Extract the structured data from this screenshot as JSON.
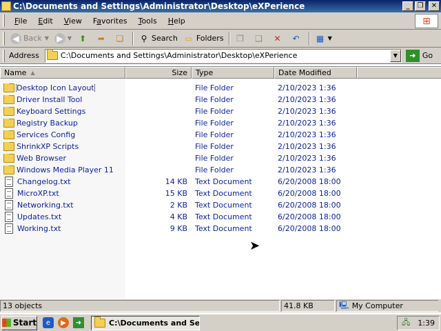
{
  "window": {
    "title": "C:\\Documents and Settings\\Administrator\\Desktop\\eXPerience",
    "controls": {
      "minimize": "_",
      "maximize": "❐",
      "close": "✕"
    }
  },
  "menubar": [
    {
      "label": "File",
      "accel": "F"
    },
    {
      "label": "Edit",
      "accel": "E"
    },
    {
      "label": "View",
      "accel": "V"
    },
    {
      "label": "Favorites",
      "accel": "a"
    },
    {
      "label": "Tools",
      "accel": "T"
    },
    {
      "label": "Help",
      "accel": "H"
    }
  ],
  "toolbar": {
    "back_label": "Back",
    "search_label": "Search",
    "folders_label": "Folders"
  },
  "address": {
    "label": "Address",
    "value": "C:\\Documents and Settings\\Administrator\\Desktop\\eXPerience",
    "go_label": "Go"
  },
  "columns": {
    "name": "Name",
    "size": "Size",
    "type": "Type",
    "date": "Date Modified"
  },
  "files": [
    {
      "name": "Desktop Icon Layout",
      "size": "",
      "type": "File Folder",
      "date": "2/10/2023 1:36",
      "kind": "folder"
    },
    {
      "name": "Driver Install Tool",
      "size": "",
      "type": "File Folder",
      "date": "2/10/2023 1:36",
      "kind": "folder"
    },
    {
      "name": "Keyboard Settings",
      "size": "",
      "type": "File Folder",
      "date": "2/10/2023 1:36",
      "kind": "folder"
    },
    {
      "name": "Registry Backup",
      "size": "",
      "type": "File Folder",
      "date": "2/10/2023 1:36",
      "kind": "folder"
    },
    {
      "name": "Services Config",
      "size": "",
      "type": "File Folder",
      "date": "2/10/2023 1:36",
      "kind": "folder"
    },
    {
      "name": "ShrinkXP Scripts",
      "size": "",
      "type": "File Folder",
      "date": "2/10/2023 1:36",
      "kind": "folder"
    },
    {
      "name": "Web Browser",
      "size": "",
      "type": "File Folder",
      "date": "2/10/2023 1:36",
      "kind": "folder"
    },
    {
      "name": "Windows Media Player 11",
      "size": "",
      "type": "File Folder",
      "date": "2/10/2023 1:36",
      "kind": "folder"
    },
    {
      "name": "Changelog.txt",
      "size": "14 KB",
      "type": "Text Document",
      "date": "6/20/2008 18:00",
      "kind": "doc"
    },
    {
      "name": "MicroXP.txt",
      "size": "15 KB",
      "type": "Text Document",
      "date": "6/20/2008 18:00",
      "kind": "doc"
    },
    {
      "name": "Networking.txt",
      "size": "2 KB",
      "type": "Text Document",
      "date": "6/20/2008 18:00",
      "kind": "doc"
    },
    {
      "name": "Updates.txt",
      "size": "4 KB",
      "type": "Text Document",
      "date": "6/20/2008 18:00",
      "kind": "doc"
    },
    {
      "name": "Working.txt",
      "size": "9 KB",
      "type": "Text Document",
      "date": "6/20/2008 18:00",
      "kind": "doc"
    }
  ],
  "status": {
    "count": "13 objects",
    "size": "41.8 KB",
    "location": "My Computer"
  },
  "taskbar": {
    "start_label": "Start",
    "task_label": "C:\\Documents and Se...",
    "clock": "1:39"
  },
  "colors": {
    "title_bar": "#0a246a",
    "file_text": "#0b1f9d",
    "chrome": "#d4d0c8"
  }
}
